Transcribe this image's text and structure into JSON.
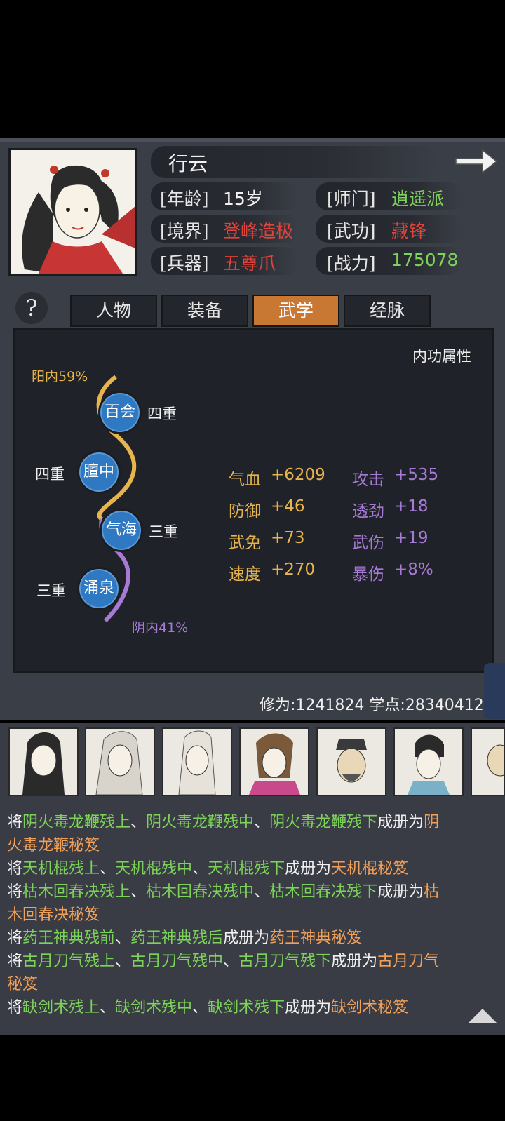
{
  "character": {
    "name": "行云",
    "age_label": "[年龄]",
    "age_value": "15岁",
    "sect_label": "[师门]",
    "sect_value": "逍遥派",
    "realm_label": "[境界]",
    "realm_value": "登峰造极",
    "skill_label": "[武功]",
    "skill_value": "藏锋",
    "weapon_label": "[兵器]",
    "weapon_value": "五尊爪",
    "power_label": "[战力]",
    "power_value": "175078"
  },
  "tabs": {
    "help": "?",
    "items": [
      "人物",
      "装备",
      "武学",
      "经脉"
    ],
    "active": "武学"
  },
  "meridian": {
    "panel_title": "内功属性",
    "yang_label": "阳内59%",
    "yin_label": "阴内41%",
    "yang_percent": 59,
    "yin_percent": 41,
    "nodes": [
      {
        "name": "百会",
        "level": "四重"
      },
      {
        "name": "膻中",
        "level": "四重"
      },
      {
        "name": "气海",
        "level": "三重"
      },
      {
        "name": "涌泉",
        "level": "三重"
      }
    ]
  },
  "stats": {
    "yang": [
      {
        "name": "气血",
        "value": "+6209"
      },
      {
        "name": "防御",
        "value": "+46"
      },
      {
        "name": "武免",
        "value": "+73"
      },
      {
        "name": "速度",
        "value": "+270"
      }
    ],
    "yin": [
      {
        "name": "攻击",
        "value": "+535"
      },
      {
        "name": "透劲",
        "value": "+18"
      },
      {
        "name": "武伤",
        "value": "+19"
      },
      {
        "name": "暴伤",
        "value": "+8%"
      }
    ]
  },
  "cultivation": {
    "text": "修为:1241824  学点:28340412"
  },
  "log": {
    "lines": [
      [
        [
          "将",
          "w"
        ],
        [
          "阴火毒龙鞭残上",
          "g"
        ],
        [
          "、",
          "w"
        ],
        [
          "阴火毒龙鞭残中",
          "g"
        ],
        [
          "、",
          "w"
        ],
        [
          "阴火毒龙鞭残下",
          "g"
        ],
        [
          "成册为",
          "w"
        ],
        [
          "阴",
          "o"
        ]
      ],
      [
        [
          "火毒龙鞭秘笈",
          "o"
        ]
      ],
      [
        [
          "将",
          "w"
        ],
        [
          "天机棍残上",
          "g"
        ],
        [
          "、",
          "w"
        ],
        [
          "天机棍残中",
          "g"
        ],
        [
          "、",
          "w"
        ],
        [
          "天机棍残下",
          "g"
        ],
        [
          "成册为",
          "w"
        ],
        [
          "天机棍秘笈",
          "o"
        ]
      ],
      [
        [
          "将",
          "w"
        ],
        [
          "枯木回春决残上",
          "g"
        ],
        [
          "、",
          "w"
        ],
        [
          "枯木回春决残中",
          "g"
        ],
        [
          "、",
          "w"
        ],
        [
          "枯木回春决残下",
          "g"
        ],
        [
          "成册为",
          "w"
        ],
        [
          "枯",
          "o"
        ]
      ],
      [
        [
          "木回春决秘笈",
          "o"
        ]
      ],
      [
        [
          "将",
          "w"
        ],
        [
          "药王神典残前",
          "g"
        ],
        [
          "、",
          "w"
        ],
        [
          "药王神典残后",
          "g"
        ],
        [
          "成册为",
          "w"
        ],
        [
          "药王神典秘笈",
          "o"
        ]
      ],
      [
        [
          "将",
          "w"
        ],
        [
          "古月刀气残上",
          "g"
        ],
        [
          "、",
          "w"
        ],
        [
          "古月刀气残中",
          "g"
        ],
        [
          "、",
          "w"
        ],
        [
          "古月刀气残下",
          "g"
        ],
        [
          "成册为",
          "w"
        ],
        [
          "古月刀气",
          "o"
        ]
      ],
      [
        [
          "秘笈",
          "o"
        ]
      ],
      [
        [
          "将",
          "w"
        ],
        [
          "缺剑术残上",
          "g"
        ],
        [
          "、",
          "w"
        ],
        [
          "缺剑术残中",
          "g"
        ],
        [
          "、",
          "w"
        ],
        [
          "缺剑术残下",
          "g"
        ],
        [
          "成册为",
          "w"
        ],
        [
          "缺剑术秘笈",
          "o"
        ]
      ]
    ]
  },
  "colors": {
    "accent_tab": "#c87832",
    "yang": "#e8b54c",
    "yin": "#a77ad6",
    "node": "#2f78c2",
    "green_text": "#7dd35a",
    "red_text": "#e0443c",
    "orange_text": "#f0a058"
  },
  "icons": [
    "arrow-right-icon",
    "help-icon",
    "scroll-up-icon"
  ]
}
